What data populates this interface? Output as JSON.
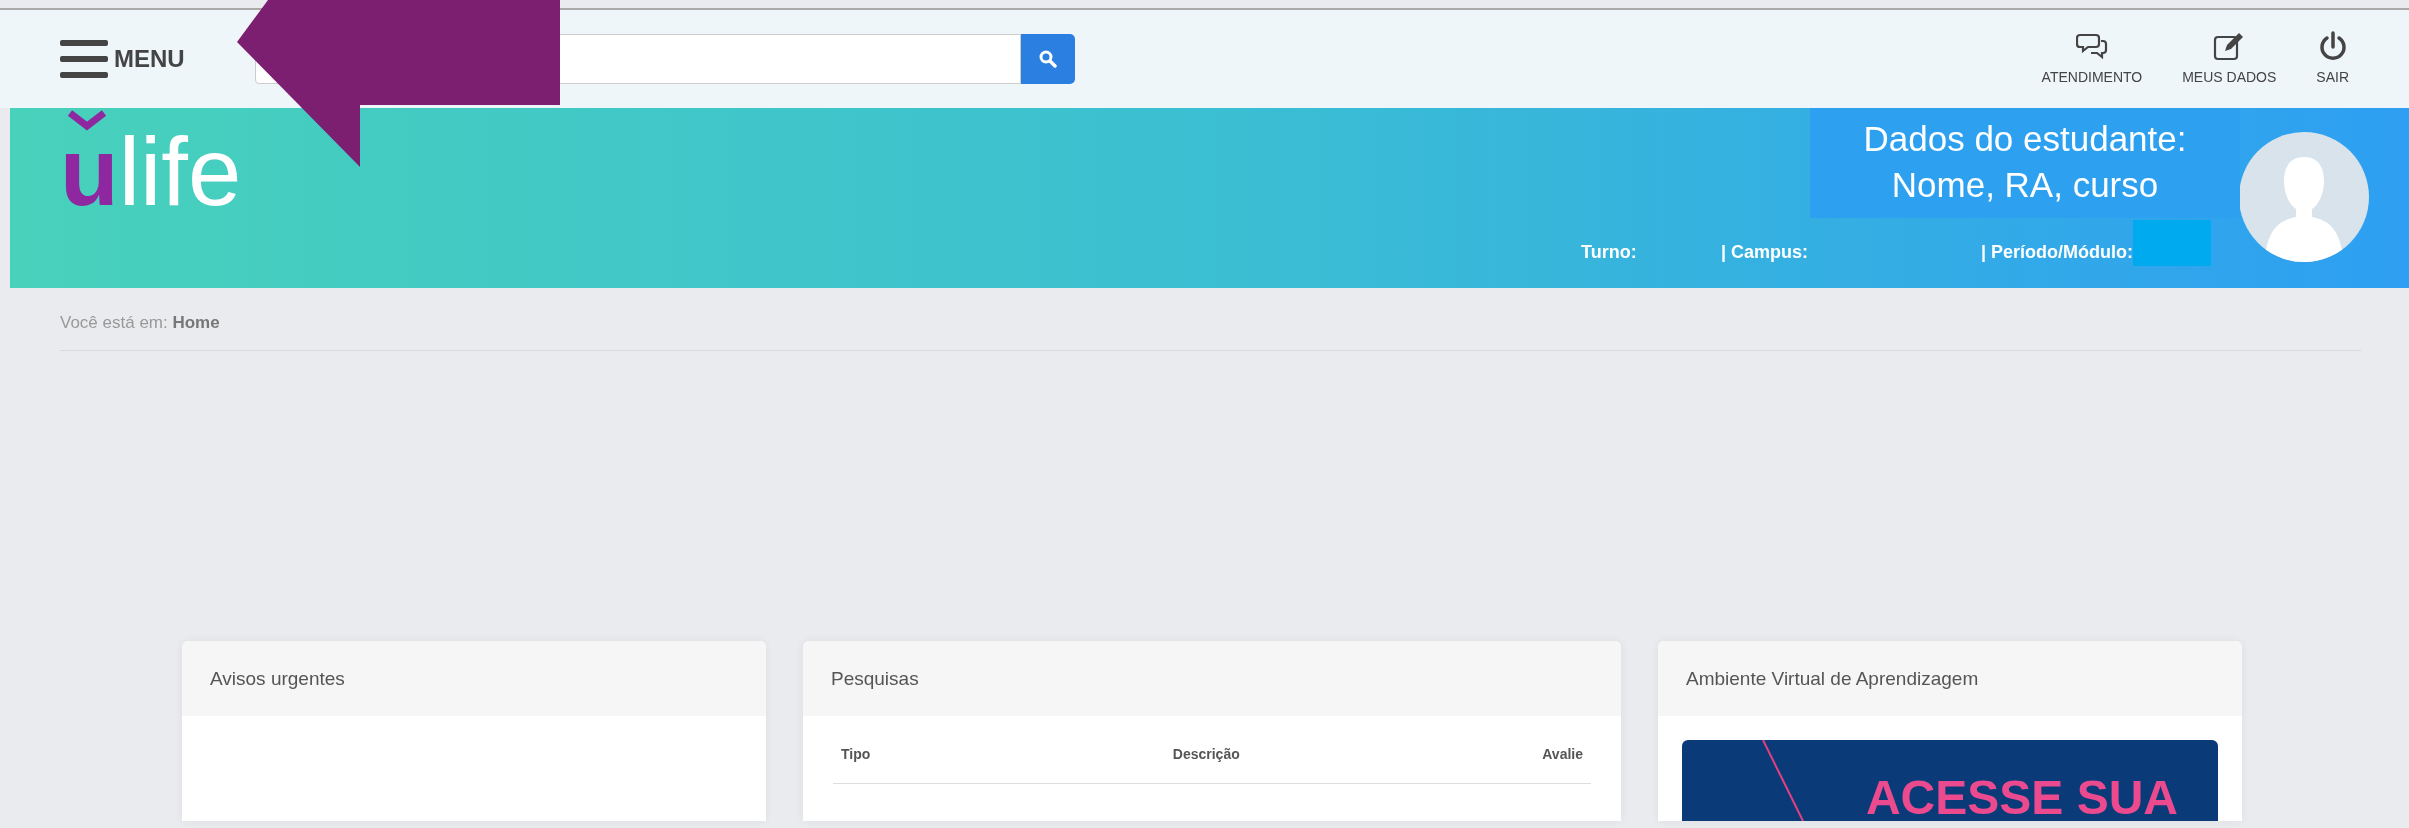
{
  "top_bar": {
    "menu_label": "MENU",
    "actions": [
      {
        "kind": "chat",
        "label": "ATENDIMENTO"
      },
      {
        "kind": "edit",
        "label": "MEUS DADOS"
      },
      {
        "kind": "power",
        "label": "SAIR"
      }
    ]
  },
  "header": {
    "logo": {
      "accent": "u",
      "text": "life"
    },
    "student_fields": [
      "Turno:",
      "| Campus:",
      "| Período/Módulo:"
    ],
    "annotation": [
      "Dados do estudante:",
      "Nome, RA, curso"
    ]
  },
  "breadcrumb": {
    "prefix": "Você está em:",
    "current": "Home"
  },
  "cards": [
    {
      "kind": "empty",
      "title": "Avisos urgentes"
    },
    {
      "kind": "table",
      "title": "Pesquisas",
      "columns": [
        "Tipo",
        "Descrição",
        "Avalie"
      ]
    },
    {
      "kind": "banner",
      "title": "Ambiente Virtual de Aprendizagem",
      "banner_text": "ACESSE SUA"
    }
  ]
}
